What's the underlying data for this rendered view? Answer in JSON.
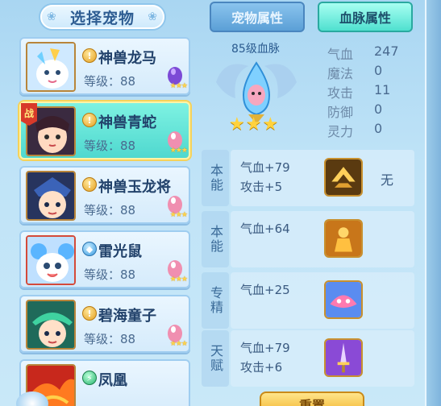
{
  "left_panel": {
    "title": "选择宠物",
    "pets": [
      {
        "name": "神兽龙马",
        "level": "等级：88",
        "element": "gold",
        "element_glyph": "!",
        "selected": false,
        "battle": false
      },
      {
        "name": "神兽青蛇",
        "level": "等级：88",
        "element": "gold",
        "element_glyph": "!",
        "selected": true,
        "battle": true,
        "battle_label": "战"
      },
      {
        "name": "神兽玉龙将",
        "level": "等级：88",
        "element": "gold",
        "element_glyph": "!",
        "selected": false,
        "battle": false
      },
      {
        "name": "雷光鼠",
        "level": "等级：88",
        "element": "blue",
        "element_glyph": "◆",
        "selected": false,
        "battle": false
      },
      {
        "name": "碧海童子",
        "level": "等级：88",
        "element": "gold",
        "element_glyph": "!",
        "selected": false,
        "battle": false
      },
      {
        "name": "凤凰",
        "level": "",
        "element": "green",
        "element_glyph": "⚡",
        "selected": false,
        "battle": false
      }
    ]
  },
  "tabs": [
    {
      "label": "宠物属性",
      "active": false
    },
    {
      "label": "血脉属性",
      "active": true
    }
  ],
  "bloodline": {
    "title": "85级血脉",
    "stars": "★★★",
    "stats": [
      {
        "label": "气血",
        "value": "247"
      },
      {
        "label": "魔法",
        "value": "0"
      },
      {
        "label": "攻击",
        "value": "11"
      },
      {
        "label": "防御",
        "value": "0"
      },
      {
        "label": "灵力",
        "value": "0"
      }
    ]
  },
  "skills": [
    {
      "type": "本能",
      "lines": [
        "气血+79",
        "攻击+5"
      ],
      "icon": "golden-emblem-icon",
      "extra": "无"
    },
    {
      "type": "本能",
      "lines": [
        "气血+64"
      ],
      "icon": "golden-warrior-icon",
      "extra": ""
    },
    {
      "type": "专精",
      "lines": [
        "气血+25"
      ],
      "icon": "pink-beast-icon",
      "extra": ""
    },
    {
      "type": "天赋",
      "lines": [
        "气血+79",
        "攻击+6"
      ],
      "icon": "purple-sword-icon",
      "extra": ""
    }
  ],
  "bottom_button": {
    "label": "重置"
  },
  "colors": {
    "selected_card": "#4fd8cf",
    "active_tab": "#4fe0cf",
    "star": "#ffd23c"
  }
}
